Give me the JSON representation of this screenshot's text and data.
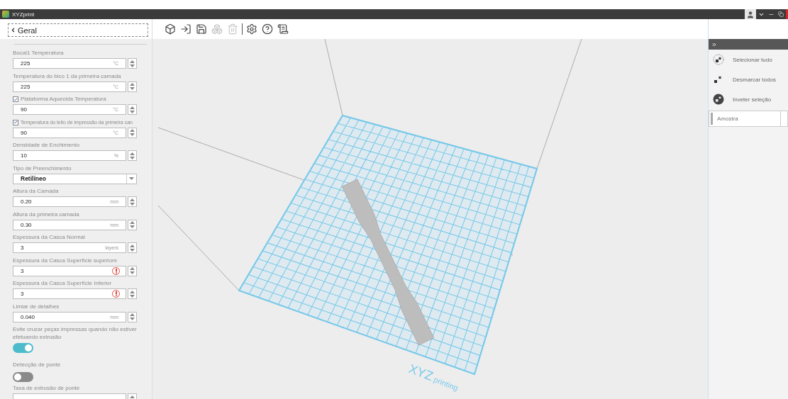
{
  "window": {
    "title": "XYZprint"
  },
  "panel": {
    "title": "Geral"
  },
  "toolbar": [
    {
      "disabled": false
    },
    {
      "disabled": false
    },
    {
      "disabled": false
    },
    {
      "disabled": true
    },
    {
      "disabled": true
    },
    {
      "disabled": false
    },
    {
      "disabled": false
    },
    {
      "disabled": false
    }
  ],
  "settings": [
    {
      "kind": "number",
      "label": "Bocal1 Temperatura",
      "value": "225",
      "unit": "°C",
      "warning": false
    },
    {
      "kind": "number",
      "label": "Temperatura do bico 1 da primeira camada",
      "value": "225",
      "unit": "°C",
      "warning": false
    },
    {
      "kind": "check_number",
      "label": "Plataforma Aquecida Temperatura",
      "checked": true,
      "value": "90",
      "unit": "°C",
      "warning": false
    },
    {
      "kind": "check_number",
      "label": "Temperatura do leito de impressão da primeira can",
      "checked": true,
      "value": "90",
      "unit": "°C",
      "warning": false
    },
    {
      "kind": "number",
      "label": "Densidade de Enchimento",
      "value": "10",
      "unit": "%",
      "warning": false
    },
    {
      "kind": "select",
      "label": "Tipo de Preenchimento",
      "value": "Retilíneo"
    },
    {
      "kind": "number",
      "label": "Altura da Camada",
      "value": "0.20",
      "unit": "mm",
      "warning": false
    },
    {
      "kind": "number",
      "label": "Altura da primeira camada",
      "value": "0.30",
      "unit": "mm",
      "warning": false
    },
    {
      "kind": "number",
      "label": "Espessura da Casca Normal",
      "value": "3",
      "unit": "layers",
      "warning": false
    },
    {
      "kind": "number",
      "label": "Espessura da Casca Superficie superiore",
      "value": "3",
      "warning": true
    },
    {
      "kind": "number",
      "label": "Espessura da Casca Superfície Inferior",
      "value": "3",
      "warning": true
    },
    {
      "kind": "number",
      "label": "Limiar de detalhes",
      "value": "0.040",
      "unit": "mm",
      "warning": false
    },
    {
      "kind": "toggle",
      "label": "Evite cruzar peças impressas quando não estiver efetuando extrusão",
      "on": true
    },
    {
      "kind": "toggle",
      "label": "Detecção de ponte",
      "on": false
    },
    {
      "kind": "number",
      "label": "Taxa de extrusão de ponte",
      "warning": false
    }
  ],
  "plate_logo": {
    "main": "XYZ",
    "sub": "printing"
  },
  "selection_panel": {
    "actions": [
      {
        "kind": "select_all",
        "label": "Selecionar tudo"
      },
      {
        "kind": "deselect_all",
        "label": "Desmarcar todos"
      },
      {
        "kind": "invert",
        "label": "Inveter seleção"
      }
    ],
    "objects": [
      {
        "label": "Amostra"
      }
    ]
  }
}
